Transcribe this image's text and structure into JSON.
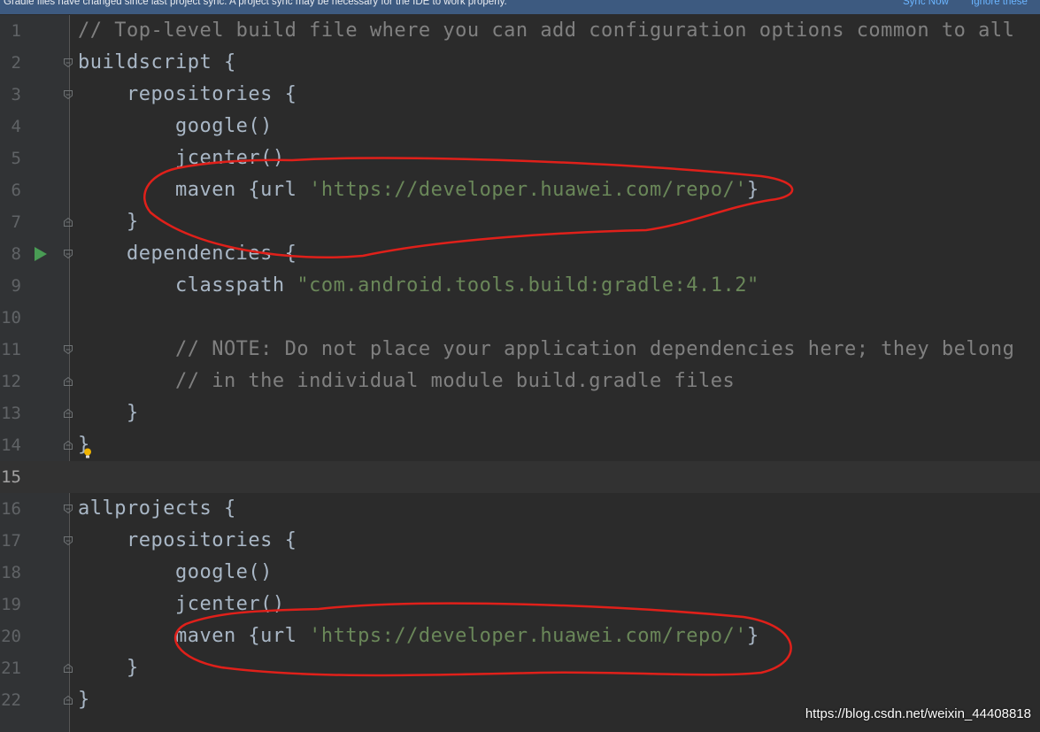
{
  "notification": {
    "message": "Gradle files have changed since last project sync. A project sync may be necessary for the IDE to work properly.",
    "sync_now": "Sync Now",
    "ignore": "Ignore these"
  },
  "lines": [
    {
      "n": "1",
      "tokens": [
        {
          "t": "// Top-level build file where you can add configuration options common to all",
          "c": "comment"
        }
      ],
      "fold": ""
    },
    {
      "n": "2",
      "tokens": [
        {
          "t": "buildscript {",
          "c": ""
        }
      ],
      "fold": "open"
    },
    {
      "n": "3",
      "tokens": [
        {
          "t": "    repositories {",
          "c": ""
        }
      ],
      "fold": "open"
    },
    {
      "n": "4",
      "tokens": [
        {
          "t": "        google()",
          "c": ""
        }
      ],
      "fold": ""
    },
    {
      "n": "5",
      "tokens": [
        {
          "t": "        jcenter()",
          "c": ""
        }
      ],
      "fold": ""
    },
    {
      "n": "6",
      "tokens": [
        {
          "t": "        maven {url ",
          "c": ""
        },
        {
          "t": "'https://developer.huawei.com/repo/'",
          "c": "str"
        },
        {
          "t": "}",
          "c": ""
        }
      ],
      "fold": ""
    },
    {
      "n": "7",
      "tokens": [
        {
          "t": "    }",
          "c": ""
        }
      ],
      "fold": "close"
    },
    {
      "n": "8",
      "tokens": [
        {
          "t": "    dependencies {",
          "c": ""
        }
      ],
      "fold": "open",
      "run": true
    },
    {
      "n": "9",
      "tokens": [
        {
          "t": "        classpath ",
          "c": ""
        },
        {
          "t": "\"com.android.tools.build:gradle:4.1.2\"",
          "c": "str"
        }
      ],
      "fold": ""
    },
    {
      "n": "10",
      "tokens": [],
      "fold": ""
    },
    {
      "n": "11",
      "tokens": [
        {
          "t": "        // NOTE: Do not place your application dependencies here; they belong",
          "c": "comment"
        }
      ],
      "fold": "open"
    },
    {
      "n": "12",
      "tokens": [
        {
          "t": "        // in the individual module build.gradle files",
          "c": "comment"
        }
      ],
      "fold": "close"
    },
    {
      "n": "13",
      "tokens": [
        {
          "t": "    }",
          "c": ""
        }
      ],
      "fold": "close"
    },
    {
      "n": "14",
      "tokens": [
        {
          "t": "}",
          "c": ""
        }
      ],
      "fold": "close",
      "bulb": true
    },
    {
      "n": "15",
      "tokens": [],
      "fold": "",
      "current": true
    },
    {
      "n": "16",
      "tokens": [
        {
          "t": "allprojects {",
          "c": ""
        }
      ],
      "fold": "open"
    },
    {
      "n": "17",
      "tokens": [
        {
          "t": "    repositories {",
          "c": ""
        }
      ],
      "fold": "open"
    },
    {
      "n": "18",
      "tokens": [
        {
          "t": "        google()",
          "c": ""
        }
      ],
      "fold": ""
    },
    {
      "n": "19",
      "tokens": [
        {
          "t": "        jcenter()",
          "c": ""
        }
      ],
      "fold": ""
    },
    {
      "n": "20",
      "tokens": [
        {
          "t": "        maven {url ",
          "c": ""
        },
        {
          "t": "'https://developer.huawei.com/repo/'",
          "c": "str"
        },
        {
          "t": "}",
          "c": ""
        }
      ],
      "fold": ""
    },
    {
      "n": "21",
      "tokens": [
        {
          "t": "    }",
          "c": ""
        }
      ],
      "fold": "close"
    },
    {
      "n": "22",
      "tokens": [
        {
          "t": "}",
          "c": ""
        }
      ],
      "fold": "close"
    }
  ],
  "watermark": "https://blog.csdn.net/weixin_44408818",
  "colors": {
    "background": "#2b2b2b",
    "gutter": "#313335",
    "comment": "#808080",
    "string": "#6a8759",
    "default": "#a9b7c6",
    "annotation": "#e0201a"
  }
}
